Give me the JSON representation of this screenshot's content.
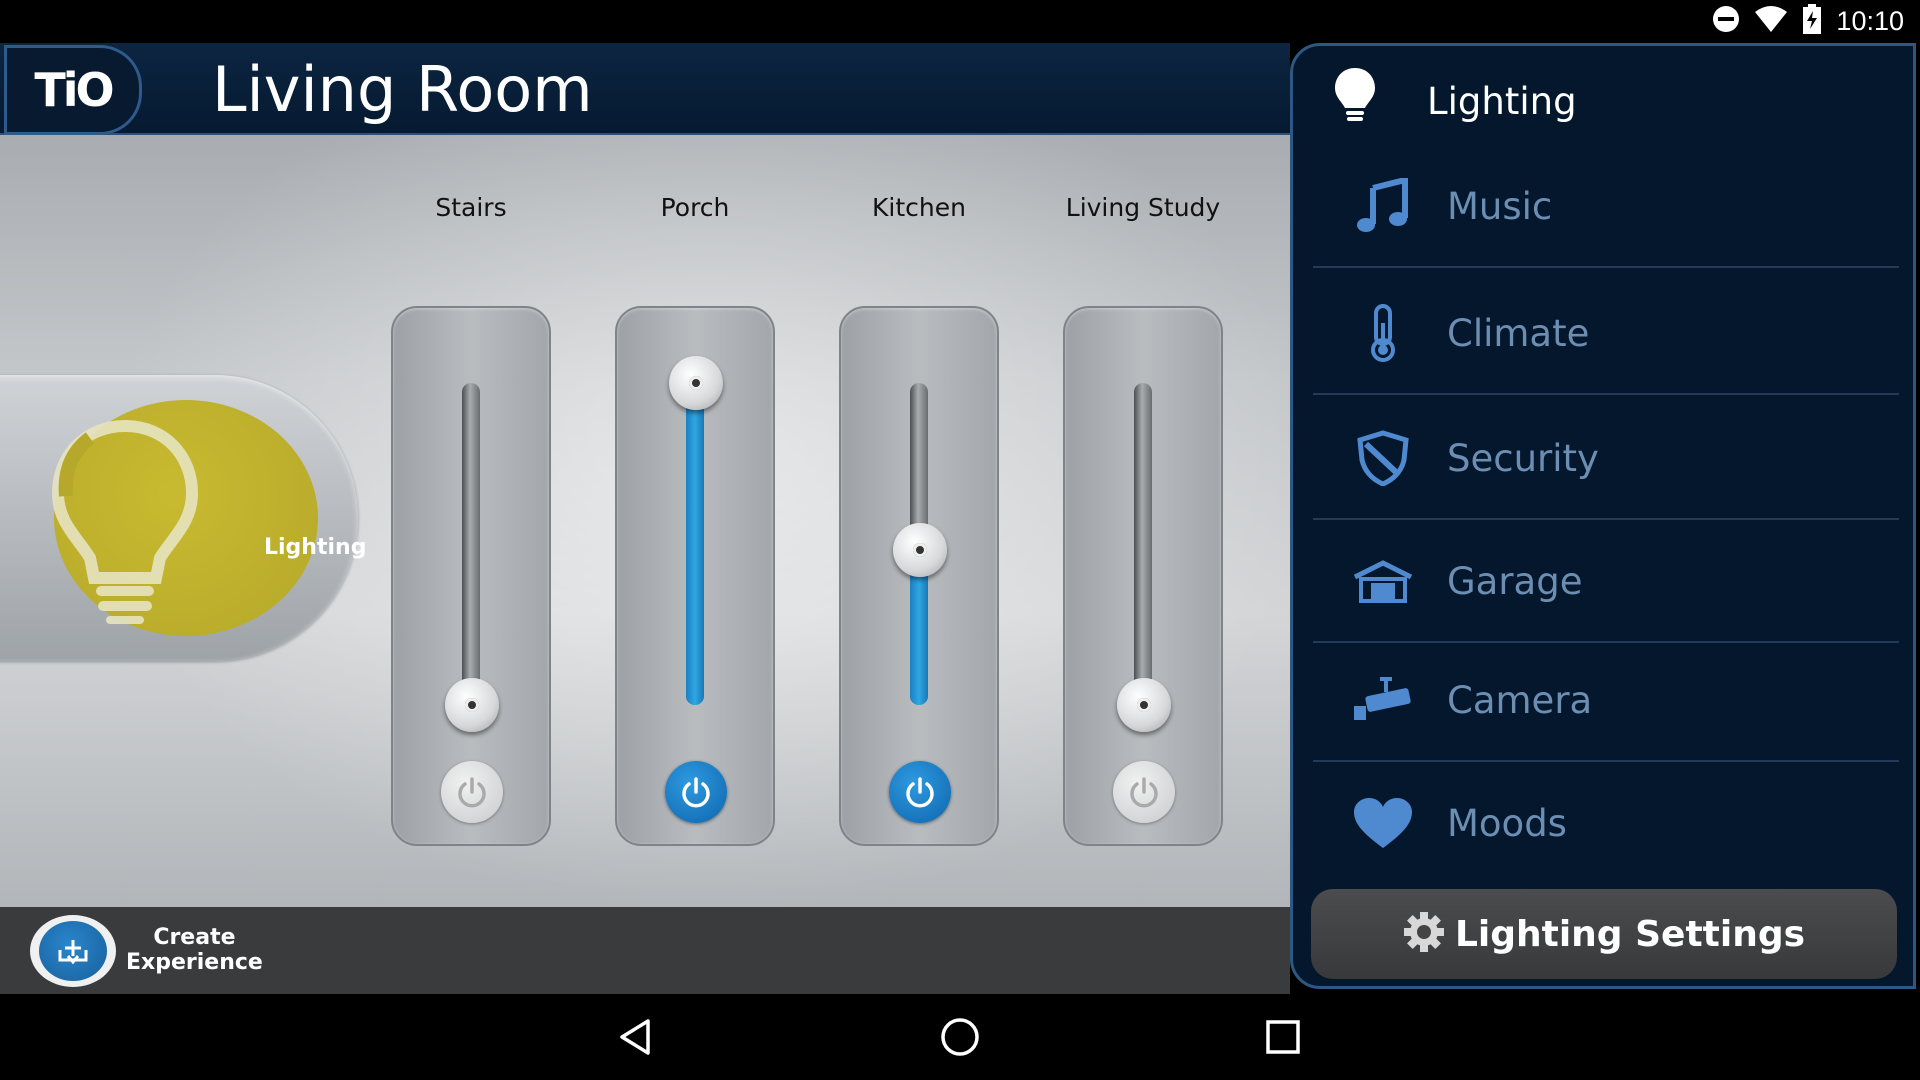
{
  "status_bar": {
    "time": "10:10",
    "icons": [
      "do-not-disturb-icon",
      "wifi-icon",
      "battery-charging-icon"
    ]
  },
  "header": {
    "logo_text": "TiO",
    "room_title": "Living Room"
  },
  "category": {
    "label": "Lighting",
    "color": "#b9ac2c"
  },
  "zones": [
    {
      "label": "Stairs",
      "level": 0,
      "on": false
    },
    {
      "label": "Porch",
      "level": 100,
      "on": true
    },
    {
      "label": "Kitchen",
      "level": 48,
      "on": true
    },
    {
      "label": "Living Study",
      "level": 0,
      "on": false
    }
  ],
  "bottom_bar": {
    "create_label_line1": "Create",
    "create_label_line2": "Experience"
  },
  "menu": {
    "header_label": "Lighting",
    "items": [
      {
        "label": "Music",
        "icon": "music-note-icon"
      },
      {
        "label": "Climate",
        "icon": "thermometer-icon"
      },
      {
        "label": "Security",
        "icon": "shield-icon"
      },
      {
        "label": "Garage",
        "icon": "garage-icon"
      },
      {
        "label": "Camera",
        "icon": "camera-icon"
      },
      {
        "label": "Moods",
        "icon": "heart-icon"
      }
    ],
    "settings_label": "Lighting Settings"
  },
  "colors": {
    "accent_blue": "#1f8fd6",
    "menu_bg": "#04172c",
    "menu_text": "#6b8eb2"
  }
}
